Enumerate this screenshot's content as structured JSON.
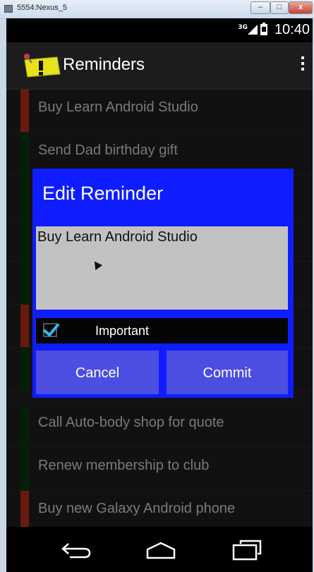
{
  "window": {
    "title": "5554:Nexus_5",
    "minimize": "–",
    "maximize": "□",
    "close": "x"
  },
  "status_bar": {
    "network": "3G",
    "time": "10:40"
  },
  "action_bar": {
    "title": "Reminders",
    "overflow_icon": "overflow-menu-icon"
  },
  "reminders": [
    {
      "text": "Buy Learn Android Studio",
      "important": true
    },
    {
      "text": "Send Dad birthday gift",
      "important": false
    },
    {
      "text": "",
      "important": false
    },
    {
      "text": "",
      "important": false
    },
    {
      "text": "",
      "important": false
    },
    {
      "text": "",
      "important": true
    },
    {
      "text": "",
      "important": false
    },
    {
      "text": "Call Auto-body shop for quote",
      "important": false
    },
    {
      "text": "Renew membership to club",
      "important": false
    },
    {
      "text": "Buy new Galaxy Android phone",
      "important": true
    }
  ],
  "dialog": {
    "title": "Edit Reminder",
    "text_value": "Buy Learn Android Studio",
    "checkbox_label": "Important",
    "checkbox_checked": true,
    "cancel_label": "Cancel",
    "commit_label": "Commit"
  },
  "colors": {
    "important": "#c0301a",
    "normal": "#0c3a10",
    "dialog_bg": "#0f1dfe",
    "button_bg": "#4b4ee0"
  }
}
